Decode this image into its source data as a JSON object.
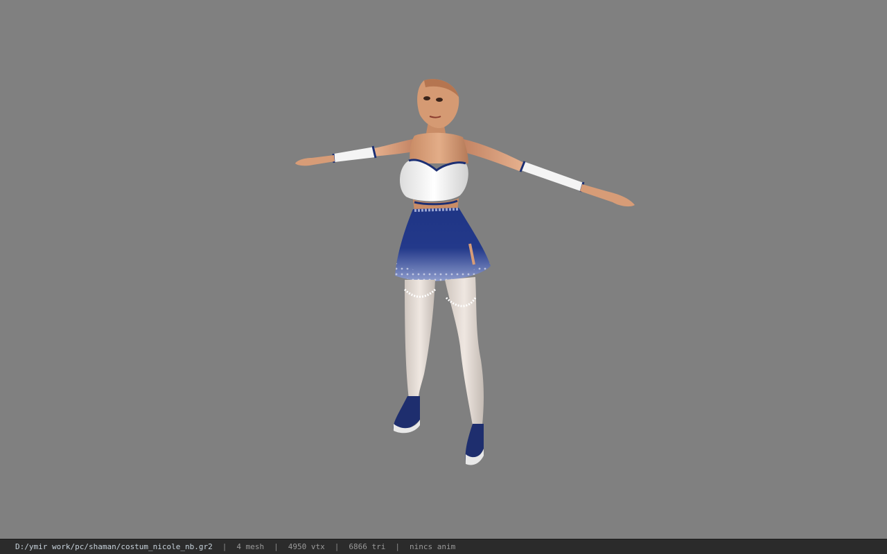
{
  "viewer": {
    "background_color": "#808080",
    "model": {
      "kind": "character-model",
      "pose": "T-pose",
      "palette": {
        "skin": "#d9a07a",
        "top": "#f2f2f2",
        "trim": "#1c2f73",
        "skirt": "#243a8a",
        "stockings": "#e6ddd6",
        "shoes": "#1e2e6e"
      }
    }
  },
  "statusbar": {
    "file_path": "D:/ymir work/pc/shaman/costum_nicole_nb.gr2",
    "separator": "|",
    "mesh_count": "4 mesh",
    "vertex_count": "4950 vtx",
    "triangle_count": "6866 tri",
    "anim_status": "nincs anim"
  }
}
